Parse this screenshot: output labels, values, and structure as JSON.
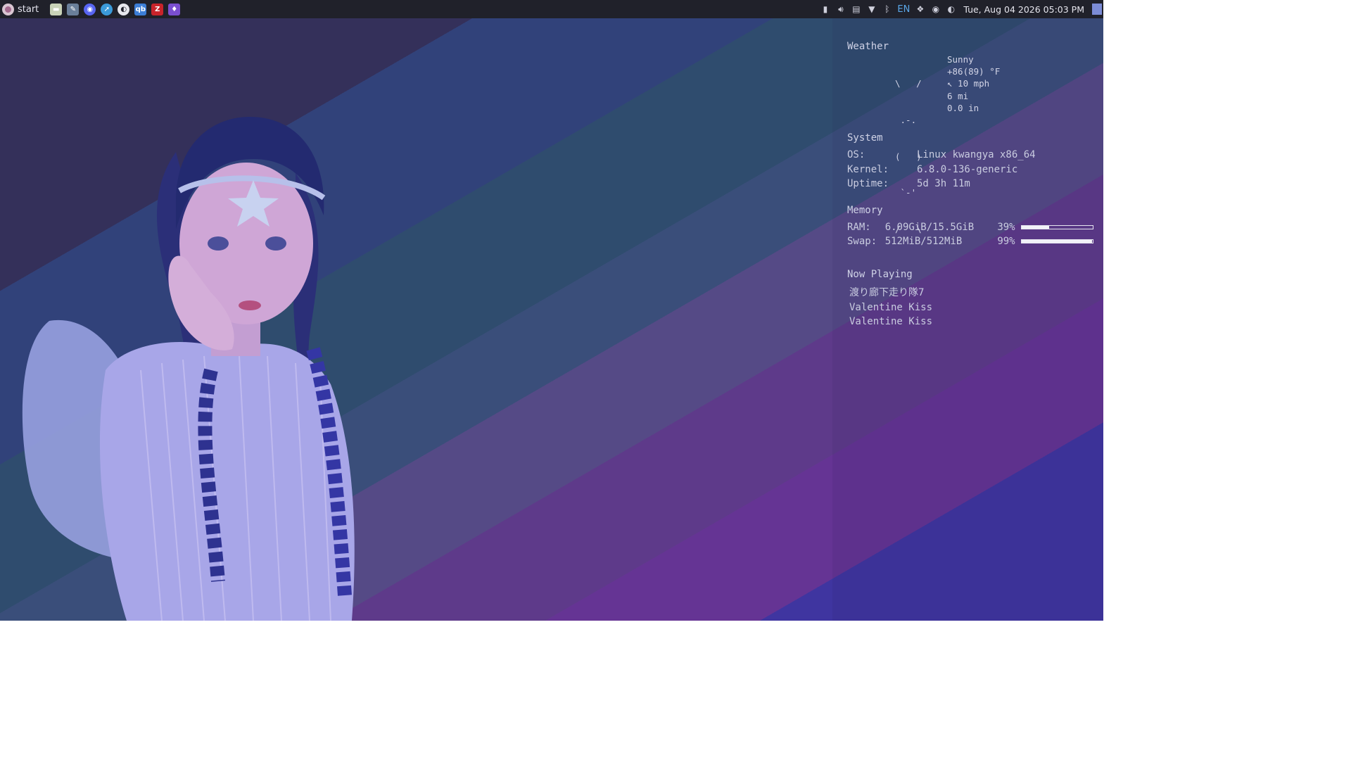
{
  "taskbar": {
    "start_label": "start",
    "launchers": [
      {
        "name": "file-manager-icon",
        "color": "#c9d3b8"
      },
      {
        "name": "text-editor-icon",
        "color": "#6a7f9a"
      },
      {
        "name": "discord-icon",
        "color": "#5865f2"
      },
      {
        "name": "browser-icon",
        "color": "#3b9ad9"
      },
      {
        "name": "steam-icon",
        "color": "#e8e8ee"
      },
      {
        "name": "qbittorrent-icon",
        "color": "#3c7ed6"
      },
      {
        "name": "filezilla-icon",
        "color": "#c8242b"
      },
      {
        "name": "vpn-icon",
        "color": "#7a4fd0"
      }
    ],
    "tray": {
      "language": "EN",
      "datetime": "Tue, Aug 04 2026 05:03 PM"
    }
  },
  "conky": {
    "weather": {
      "header": "Weather",
      "art": [
        "\\   /",
        " .-.",
        "(   )",
        " `-'",
        "/   \\"
      ],
      "condition": "Sunny",
      "temperature": "+86(89) °F",
      "wind": "↖ 10 mph",
      "visibility": "6 mi",
      "precipitation": "0.0 in"
    },
    "system": {
      "header": "System",
      "os_label": "OS:",
      "os_value": "Linux kwangya x86_64",
      "kernel_label": "Kernel:",
      "kernel_value": "6.8.0-136-generic",
      "uptime_label": "Uptime:",
      "uptime_value": "5d 3h 11m"
    },
    "memory": {
      "header": "Memory",
      "ram_label": "RAM:",
      "ram_value": "6.09GiB/15.5GiB",
      "ram_percent": "39%",
      "ram_fraction": 0.39,
      "swap_label": "Swap:",
      "swap_value": "512MiB/512MiB",
      "swap_percent": "99%",
      "swap_fraction": 0.99
    },
    "now_playing": {
      "header": "Now Playing",
      "artist": "渡り廊下走り隊7",
      "album": "Valentine Kiss",
      "title": "Valentine Kiss"
    }
  }
}
